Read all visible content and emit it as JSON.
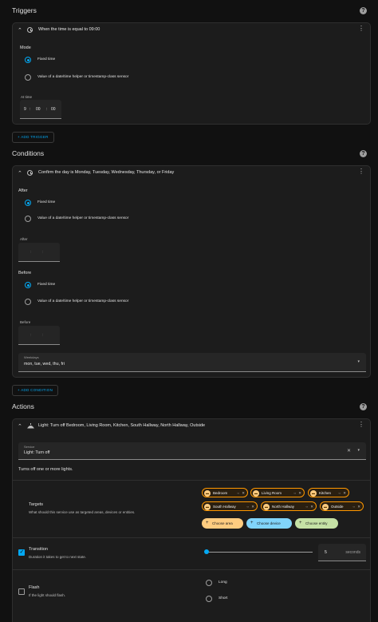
{
  "triggers": {
    "title": "Triggers",
    "card_title": "When the time is equal to 09:00",
    "mode_label": "Mode",
    "option_fixed": "Fixed time",
    "option_helper": "Value of a date/time helper or timestamp-class sensor",
    "at_time_label": "At time",
    "time": {
      "h": "9",
      "m": "00",
      "s": "00"
    },
    "add_button": "+ ADD TRIGGER"
  },
  "conditions": {
    "title": "Conditions",
    "card_title": "Confirm the day is Monday, Tuesday, Wednesday, Thursday, or Friday",
    "after_label": "After",
    "option_fixed": "Fixed time",
    "option_helper": "Value of a date/time helper or timestamp-class sensor",
    "after_small": "After",
    "before_label": "Before",
    "before_small": "Before",
    "empty_time": {
      "a": ":",
      "b": ":"
    },
    "weekdays_label": "Weekdays",
    "weekdays_value": "mon, tue, wed, thu, fri",
    "add_button": "+ ADD CONDITION"
  },
  "actions": {
    "title": "Actions",
    "card_title": "Light: Turn off Bedroom, Living Room, Kitchen, South Hallway, North Hallway, Outside",
    "service_label": "Service",
    "service_value": "Light: Turn off",
    "description": "Turns off one or more lights.",
    "targets_title": "Targets",
    "targets_desc": "What should this service use as targeted areas, devices or entities.",
    "chips": [
      "Bedroom",
      "Living Room",
      "Kitchen",
      "South Hallway",
      "North Hallway",
      "Outside"
    ],
    "choose_area": "Choose area",
    "choose_device": "Choose device",
    "choose_entity": "Choose entity",
    "transition_title": "Transition",
    "transition_desc": "Duration it takes to get to next state.",
    "transition_value": "5",
    "transition_unit": "seconds",
    "flash_title": "Flash",
    "flash_desc": "If the light should flash.",
    "flash_long": "Long",
    "flash_short": "Short"
  },
  "icons": {
    "help": "?",
    "kebab": "⋮",
    "chevron": "⌃",
    "caret": "▾",
    "clear": "✕"
  },
  "colors": {
    "accent": "#03a9f4",
    "chip_border": "#ff9800",
    "area": "#ffcc80",
    "device": "#81d4fa",
    "entity": "#c5e1a5"
  }
}
